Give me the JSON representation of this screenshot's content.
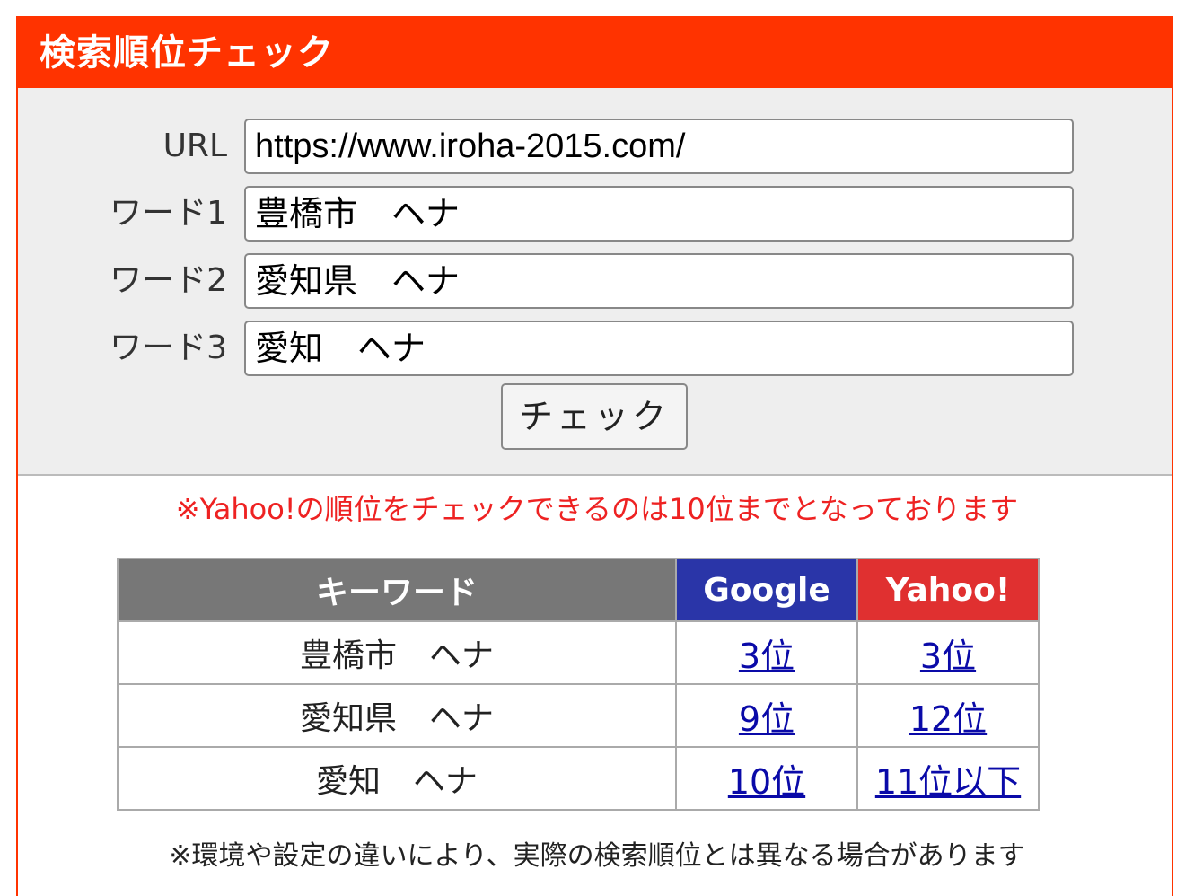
{
  "header": {
    "title": "検索順位チェック"
  },
  "form": {
    "url_label": "URL",
    "url_value": "https://www.iroha-2015.com/",
    "word1_label": "ワード1",
    "word1_value": "豊橋市　ヘナ",
    "word2_label": "ワード2",
    "word2_value": "愛知県　ヘナ",
    "word3_label": "ワード3",
    "word3_value": "愛知　ヘナ",
    "check_button": "チェック"
  },
  "notice": "※Yahoo!の順位をチェックできるのは10位までとなっております",
  "table": {
    "headers": {
      "keyword": "キーワード",
      "google": "Google",
      "yahoo": "Yahoo!"
    },
    "rows": [
      {
        "keyword": "豊橋市　ヘナ",
        "google": "3位",
        "yahoo": "3位"
      },
      {
        "keyword": "愛知県　ヘナ",
        "google": "9位",
        "yahoo": "12位"
      },
      {
        "keyword": "愛知　ヘナ",
        "google": "10位",
        "yahoo": "11位以下"
      }
    ]
  },
  "footer_note": "※環境や設定の違いにより、実際の検索順位とは異なる場合があります",
  "colors": {
    "brand": "#ff3300",
    "google_header": "#2a35a8",
    "yahoo_header": "#e03030",
    "keyword_header": "#777777",
    "notice_text": "#ee2222"
  }
}
